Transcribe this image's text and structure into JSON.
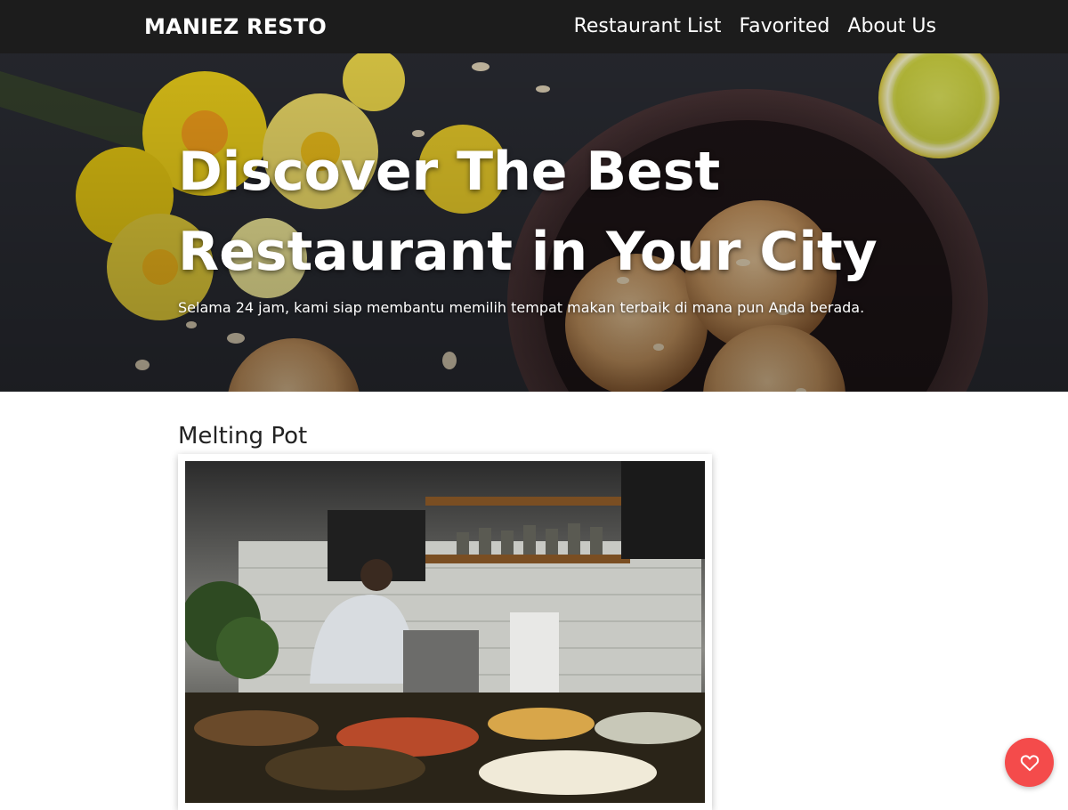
{
  "navbar": {
    "brand": "MANIEZ RESTO",
    "links": [
      {
        "label": "Restaurant List"
      },
      {
        "label": "Favorited"
      },
      {
        "label": "About Us"
      }
    ]
  },
  "hero": {
    "title_line1": "Discover The Best",
    "title_line2": "Restaurant in Your City",
    "subtitle": "Selama 24 jam, kami siap membantu memilih tempat makan terbaik di mana pun Anda berada."
  },
  "restaurants": [
    {
      "name": "Melting Pot"
    }
  ],
  "fab": {
    "icon": "heart-outline-icon"
  },
  "colors": {
    "navbar_bg": "#1c1c1c",
    "fab_bg": "#f44b4b"
  }
}
